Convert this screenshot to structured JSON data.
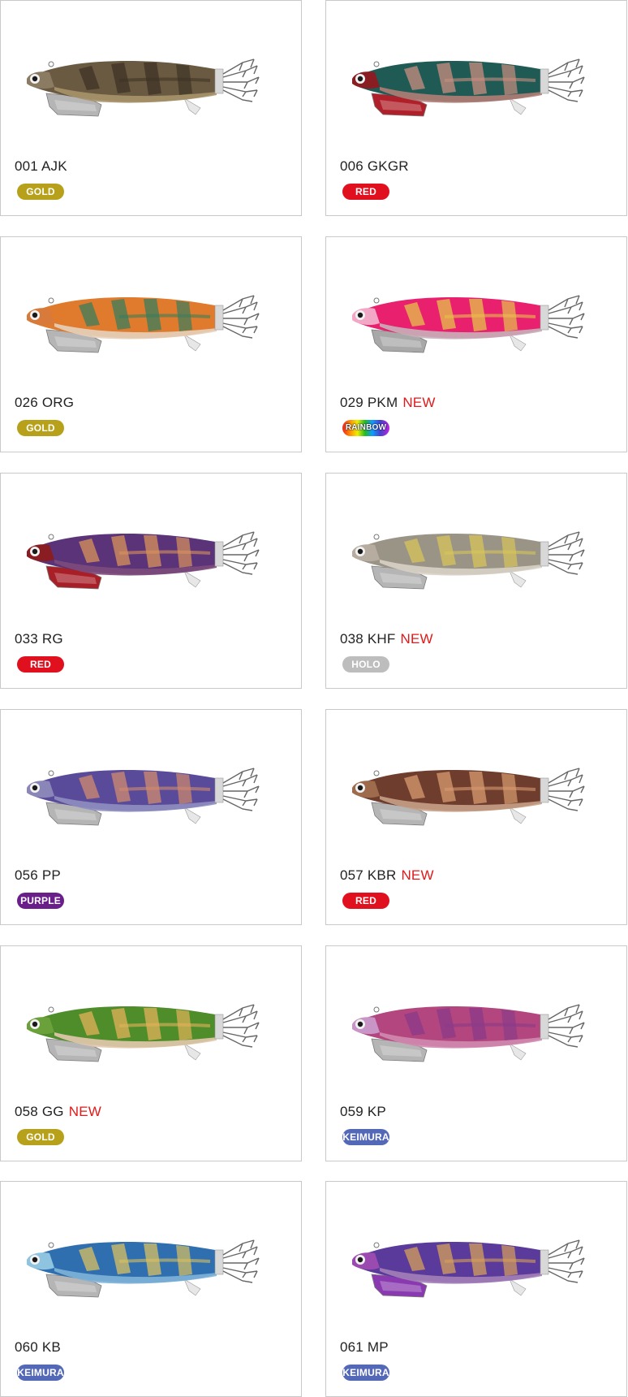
{
  "products": [
    {
      "code": "001 AJK",
      "new_label": "",
      "badge": "GOLD",
      "badge_type": "gold",
      "body_color": "#6b5a42",
      "stripe_color": "#3d3325",
      "belly_color": "#a7926a",
      "head_color": "#8a7b62",
      "sinker_color": "#b5b5b5"
    },
    {
      "code": "006 GKGR",
      "new_label": "",
      "badge": "RED",
      "badge_type": "red",
      "body_color": "#1f5a55",
      "stripe_color": "#c98d7f",
      "belly_color": "#b07d76",
      "head_color": "#8a1d22",
      "sinker_color": "#b0202a"
    },
    {
      "code": "026 ORG",
      "new_label": "",
      "badge": "GOLD",
      "badge_type": "gold",
      "body_color": "#e07a2c",
      "stripe_color": "#3a7e5c",
      "belly_color": "#e5d2bd",
      "head_color": "#d77a3a",
      "sinker_color": "#b5b5b5"
    },
    {
      "code": "029 PKM",
      "new_label": "NEW",
      "badge": "RAINBOW",
      "badge_type": "rainbow",
      "body_color": "#e8206e",
      "stripe_color": "#e6c24a",
      "belly_color": "#c7b0b8",
      "head_color": "#f2a7c6",
      "sinker_color": "#a8a8a8"
    },
    {
      "code": "033 RG",
      "new_label": "",
      "badge": "RED",
      "badge_type": "red",
      "body_color": "#5a3378",
      "stripe_color": "#d9935b",
      "belly_color": "#7d4b7c",
      "head_color": "#8a1d22",
      "sinker_color": "#a91f27"
    },
    {
      "code": "038 KHF",
      "new_label": "NEW",
      "badge": "HOLO",
      "badge_type": "holo",
      "body_color": "#9a9487",
      "stripe_color": "#d7c45a",
      "belly_color": "#d8d2c6",
      "head_color": "#b6ada0",
      "sinker_color": "#b5b5b5"
    },
    {
      "code": "056 PP",
      "new_label": "",
      "badge": "PURPLE",
      "badge_type": "purple",
      "body_color": "#5a4b9a",
      "stripe_color": "#d08a6c",
      "belly_color": "#8e8ec0",
      "head_color": "#8b86b8",
      "sinker_color": "#b5b5b5"
    },
    {
      "code": "057 KBR",
      "new_label": "NEW",
      "badge": "RED",
      "badge_type": "red",
      "body_color": "#6e3d2e",
      "stripe_color": "#d79b6f",
      "belly_color": "#c7a087",
      "head_color": "#9e6b4c",
      "sinker_color": "#b5b5b5"
    },
    {
      "code": "058 GG",
      "new_label": "NEW",
      "badge": "GOLD",
      "badge_type": "gold",
      "body_color": "#4f8c2a",
      "stripe_color": "#e2b25a",
      "belly_color": "#e3c8ad",
      "head_color": "#6aa13a",
      "sinker_color": "#b5b5b5"
    },
    {
      "code": "059 KP",
      "new_label": "",
      "badge": "KEIMURA",
      "badge_type": "keimura",
      "body_color": "#b3467e",
      "stripe_color": "#8a3a8a",
      "belly_color": "#d08ab0",
      "head_color": "#c995c6",
      "sinker_color": "#b5b5b5"
    },
    {
      "code": "060 KB",
      "new_label": "",
      "badge": "KEIMURA",
      "badge_type": "keimura",
      "body_color": "#2f6fb0",
      "stripe_color": "#d9c060",
      "belly_color": "#7fb3d8",
      "head_color": "#8fc4e0",
      "sinker_color": "#b5b5b5"
    },
    {
      "code": "061 MP",
      "new_label": "",
      "badge": "KEIMURA",
      "badge_type": "keimura",
      "body_color": "#5a3a9a",
      "stripe_color": "#d6a05a",
      "belly_color": "#a37fb8",
      "head_color": "#9b4bb0",
      "sinker_color": "#8a3ab0"
    }
  ]
}
